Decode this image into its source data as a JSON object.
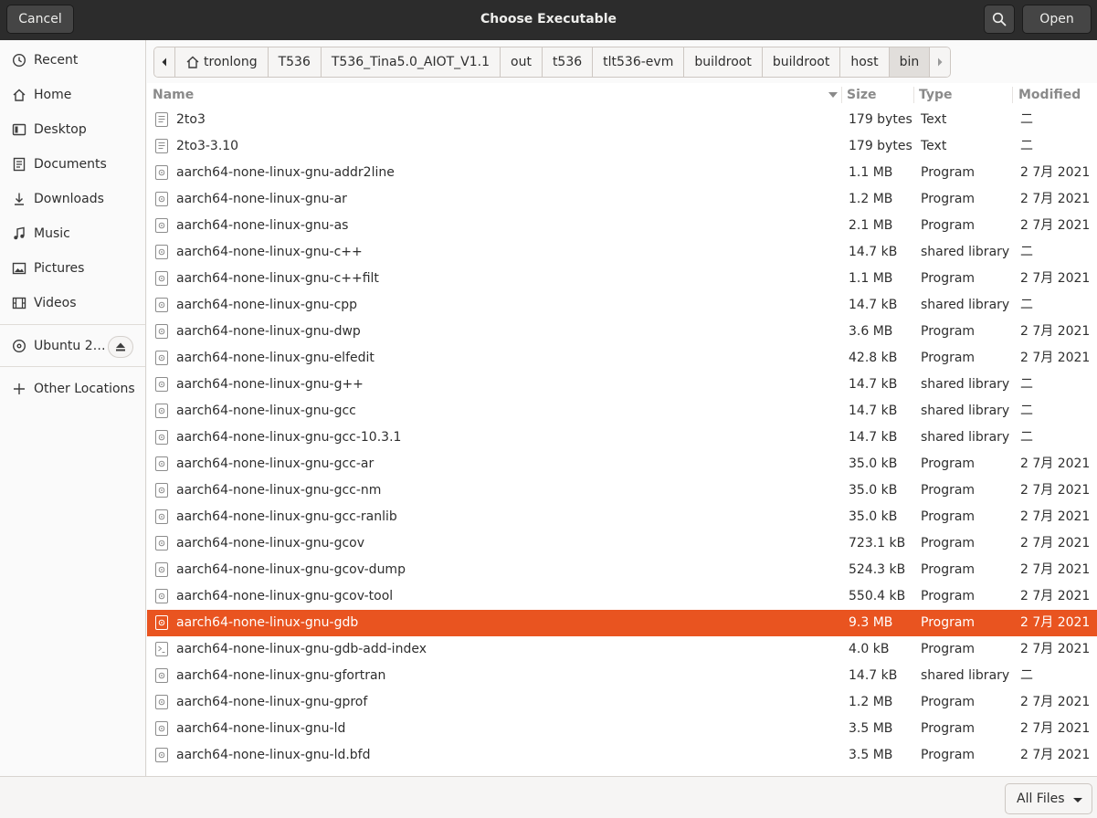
{
  "header": {
    "title": "Choose Executable",
    "cancel_label": "Cancel",
    "open_label": "Open",
    "search_icon": "search-icon"
  },
  "sidebar": {
    "items": [
      {
        "label": "Recent",
        "icon": "clock-icon"
      },
      {
        "label": "Home",
        "icon": "home-icon"
      },
      {
        "label": "Desktop",
        "icon": "desktop-icon"
      },
      {
        "label": "Documents",
        "icon": "documents-icon"
      },
      {
        "label": "Downloads",
        "icon": "downloads-icon"
      },
      {
        "label": "Music",
        "icon": "music-icon"
      },
      {
        "label": "Pictures",
        "icon": "pictures-icon"
      },
      {
        "label": "Videos",
        "icon": "videos-icon"
      }
    ],
    "device": {
      "label": "Ubuntu 2…",
      "icon": "disc-icon",
      "eject_icon": "eject-icon"
    },
    "other": {
      "label": "Other Locations",
      "icon": "plus-icon"
    }
  },
  "pathbar": {
    "crumbs": [
      "tronlong",
      "T536",
      "T536_Tina5.0_AIOT_V1.1",
      "out",
      "t536",
      "tlt536-evm",
      "buildroot",
      "buildroot",
      "host",
      "bin"
    ],
    "active_index": 9
  },
  "columns": {
    "name": "Name",
    "size": "Size",
    "type": "Type",
    "modified": "Modified"
  },
  "files": [
    {
      "name": "2to3",
      "size": "179 bytes",
      "type": "Text",
      "modified": "二",
      "icon": "text-file-icon"
    },
    {
      "name": "2to3-3.10",
      "size": "179 bytes",
      "type": "Text",
      "modified": "二",
      "icon": "text-file-icon"
    },
    {
      "name": "aarch64-none-linux-gnu-addr2line",
      "size": "1.1 MB",
      "type": "Program",
      "modified": "2 7月 2021",
      "icon": "executable-icon"
    },
    {
      "name": "aarch64-none-linux-gnu-ar",
      "size": "1.2 MB",
      "type": "Program",
      "modified": "2 7月 2021",
      "icon": "executable-icon"
    },
    {
      "name": "aarch64-none-linux-gnu-as",
      "size": "2.1 MB",
      "type": "Program",
      "modified": "2 7月 2021",
      "icon": "executable-icon"
    },
    {
      "name": "aarch64-none-linux-gnu-c++",
      "size": "14.7 kB",
      "type": "shared library",
      "modified": "二",
      "icon": "executable-icon"
    },
    {
      "name": "aarch64-none-linux-gnu-c++filt",
      "size": "1.1 MB",
      "type": "Program",
      "modified": "2 7月 2021",
      "icon": "executable-icon"
    },
    {
      "name": "aarch64-none-linux-gnu-cpp",
      "size": "14.7 kB",
      "type": "shared library",
      "modified": "二",
      "icon": "executable-icon"
    },
    {
      "name": "aarch64-none-linux-gnu-dwp",
      "size": "3.6 MB",
      "type": "Program",
      "modified": "2 7月 2021",
      "icon": "executable-icon"
    },
    {
      "name": "aarch64-none-linux-gnu-elfedit",
      "size": "42.8 kB",
      "type": "Program",
      "modified": "2 7月 2021",
      "icon": "executable-icon"
    },
    {
      "name": "aarch64-none-linux-gnu-g++",
      "size": "14.7 kB",
      "type": "shared library",
      "modified": "二",
      "icon": "executable-icon"
    },
    {
      "name": "aarch64-none-linux-gnu-gcc",
      "size": "14.7 kB",
      "type": "shared library",
      "modified": "二",
      "icon": "executable-icon"
    },
    {
      "name": "aarch64-none-linux-gnu-gcc-10.3.1",
      "size": "14.7 kB",
      "type": "shared library",
      "modified": "二",
      "icon": "executable-icon"
    },
    {
      "name": "aarch64-none-linux-gnu-gcc-ar",
      "size": "35.0 kB",
      "type": "Program",
      "modified": "2 7月 2021",
      "icon": "executable-icon"
    },
    {
      "name": "aarch64-none-linux-gnu-gcc-nm",
      "size": "35.0 kB",
      "type": "Program",
      "modified": "2 7月 2021",
      "icon": "executable-icon"
    },
    {
      "name": "aarch64-none-linux-gnu-gcc-ranlib",
      "size": "35.0 kB",
      "type": "Program",
      "modified": "2 7月 2021",
      "icon": "executable-icon"
    },
    {
      "name": "aarch64-none-linux-gnu-gcov",
      "size": "723.1 kB",
      "type": "Program",
      "modified": "2 7月 2021",
      "icon": "executable-icon"
    },
    {
      "name": "aarch64-none-linux-gnu-gcov-dump",
      "size": "524.3 kB",
      "type": "Program",
      "modified": "2 7月 2021",
      "icon": "executable-icon"
    },
    {
      "name": "aarch64-none-linux-gnu-gcov-tool",
      "size": "550.4 kB",
      "type": "Program",
      "modified": "2 7月 2021",
      "icon": "executable-icon"
    },
    {
      "name": "aarch64-none-linux-gnu-gdb",
      "size": "9.3 MB",
      "type": "Program",
      "modified": "2 7月 2021",
      "icon": "executable-icon",
      "selected": true
    },
    {
      "name": "aarch64-none-linux-gnu-gdb-add-index",
      "size": "4.0 kB",
      "type": "Program",
      "modified": "2 7月 2021",
      "icon": "script-icon"
    },
    {
      "name": "aarch64-none-linux-gnu-gfortran",
      "size": "14.7 kB",
      "type": "shared library",
      "modified": "二",
      "icon": "executable-icon"
    },
    {
      "name": "aarch64-none-linux-gnu-gprof",
      "size": "1.2 MB",
      "type": "Program",
      "modified": "2 7月 2021",
      "icon": "executable-icon"
    },
    {
      "name": "aarch64-none-linux-gnu-ld",
      "size": "3.5 MB",
      "type": "Program",
      "modified": "2 7月 2021",
      "icon": "executable-icon"
    },
    {
      "name": "aarch64-none-linux-gnu-ld.bfd",
      "size": "3.5 MB",
      "type": "Program",
      "modified": "2 7月 2021",
      "icon": "executable-icon"
    }
  ],
  "footer": {
    "filter_label": "All Files"
  },
  "colors": {
    "accent": "#e95420",
    "headerbar": "#2c2c2c"
  }
}
